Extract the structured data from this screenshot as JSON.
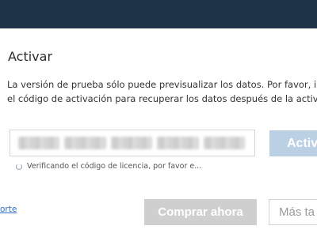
{
  "dialog": {
    "title": "Activar",
    "description_line1": "La versión de prueba sólo puede previsualizar los datos. Por favor, intr",
    "description_line2": "el código de activación para recuperar los datos después de la activaci"
  },
  "form": {
    "activate_label": "Activ",
    "status_text": "Verificando el código de licencia, por favor e..."
  },
  "footer": {
    "support_link": "orte",
    "buy_label": "Comprar ahora",
    "later_label": "Más ta"
  },
  "colors": {
    "titlebar": "#1f3346",
    "link": "#2f6fc3",
    "activate_button": "#bcd0e4",
    "buy_button": "#cfcfcf"
  },
  "icons": {
    "status": "spinner-icon"
  }
}
